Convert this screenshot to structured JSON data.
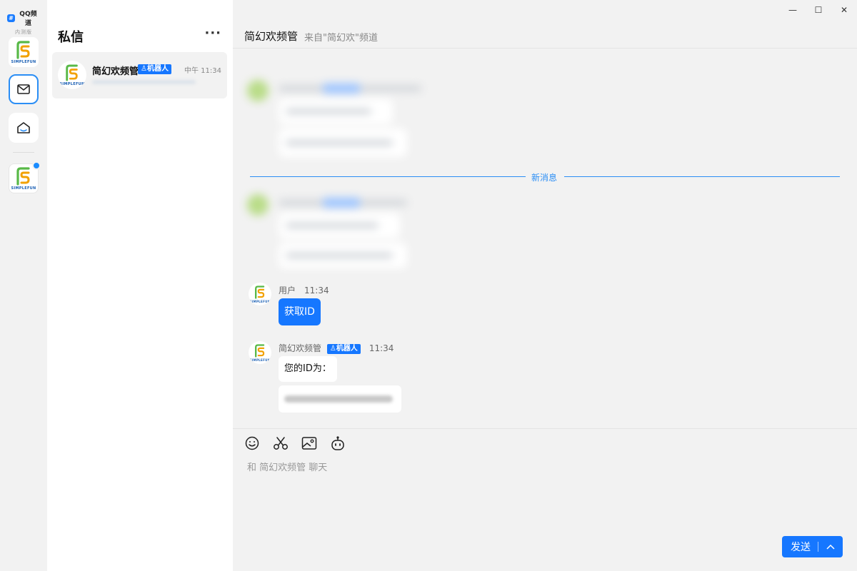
{
  "app": {
    "brand_badge": "#",
    "brand_name": "QQ频道",
    "brand_sub": "内测版"
  },
  "rail": {
    "logo_icon": "simplefun-logo",
    "items": [
      {
        "name": "mail-icon",
        "selected": true
      },
      {
        "name": "home-icon",
        "selected": false
      }
    ],
    "channel_icon": "simplefun-logo",
    "channel_unread": true
  },
  "logo": {
    "text": "SIMPLEFUN"
  },
  "list": {
    "title": "私信",
    "more": "···",
    "conversations": [
      {
        "name": "简幻欢频管",
        "tag": "机器人",
        "time": "中午 11:34",
        "preview_redacted": true
      }
    ]
  },
  "chat": {
    "title": "简幻欢频管",
    "subtitle": "来自\"简幻欢\"频道",
    "window_controls": {
      "minimize": "—",
      "maximize": "☐",
      "close": "✕"
    },
    "new_messages_divider": "新消息",
    "messages": [
      {
        "sender": "用户",
        "time": "11:34",
        "text": "获取ID",
        "style": "blue"
      },
      {
        "sender": "简幻欢频管",
        "tag": "机器人",
        "time": "11:34",
        "text": "您的ID为：",
        "redacted_followup": true
      }
    ]
  },
  "composer": {
    "tools": [
      "smile-icon",
      "scissors-icon",
      "image-icon",
      "robot-icon"
    ],
    "placeholder": "和 简幻欢频管 聊天",
    "send_label": "发送"
  },
  "colors": {
    "accent": "#1677ff",
    "rail_bg": "#f2f2f2",
    "list_bg": "#ffffff",
    "chat_bg": "#f2f2f2"
  }
}
